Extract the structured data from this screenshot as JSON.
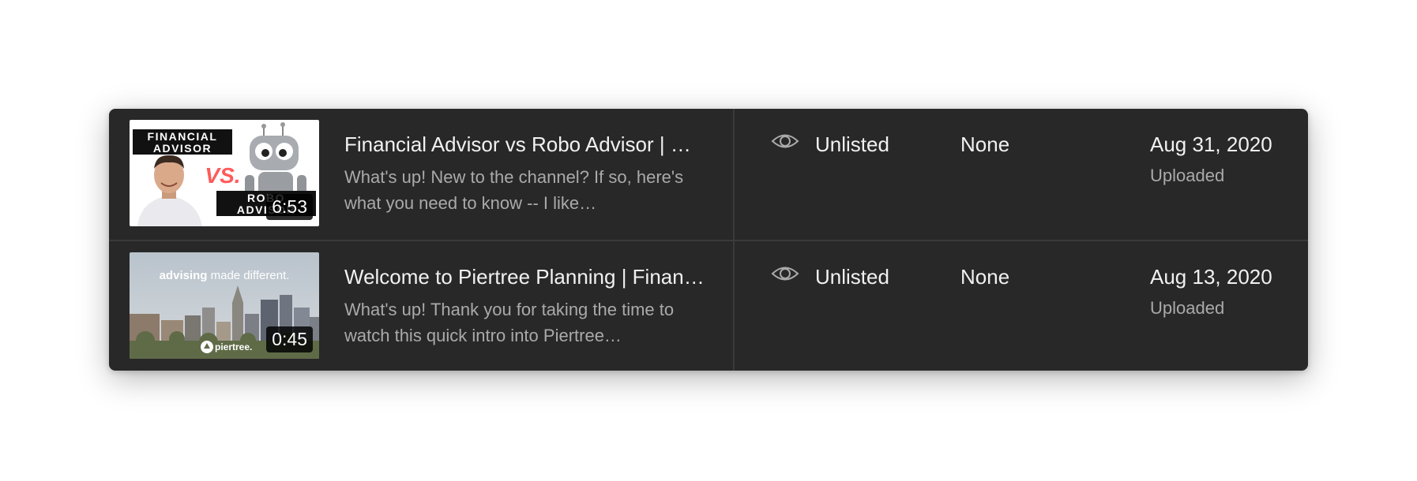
{
  "videos": [
    {
      "thumbnail": {
        "top_label": "FINANCIAL ADVISOR",
        "top_label_line1": "FINANCIAL",
        "top_label_line2": "ADVISOR",
        "vs_label": "VS.",
        "bottom_label_line1": "ROBO",
        "bottom_label_line2": "ADVISOR",
        "duration": "6:53"
      },
      "title": "Financial Advisor vs Robo Advisor | W…",
      "description": "What's up! New to the channel? If so, here's what you need to know -- I like…",
      "visibility": "Unlisted",
      "visibility_icon": "eye-icon",
      "restrictions": "None",
      "date": "Aug 31, 2020",
      "date_status": "Uploaded"
    },
    {
      "thumbnail": {
        "tagline_bold": "advising",
        "tagline_rest": " made different.",
        "brand": "piertree.",
        "duration": "0:45"
      },
      "title": "Welcome to Piertree Planning | Financ…",
      "description": "What's up! Thank you for taking the time to watch this quick intro into Piertree…",
      "visibility": "Unlisted",
      "visibility_icon": "eye-icon",
      "restrictions": "None",
      "date": "Aug 13, 2020",
      "date_status": "Uploaded"
    }
  ],
  "colors": {
    "panel_bg": "#282828",
    "primary_text": "#f1f1f1",
    "secondary_text": "#aaaaaa",
    "divider": "#3a3a3a",
    "vs_red": "#ff5a5a"
  }
}
